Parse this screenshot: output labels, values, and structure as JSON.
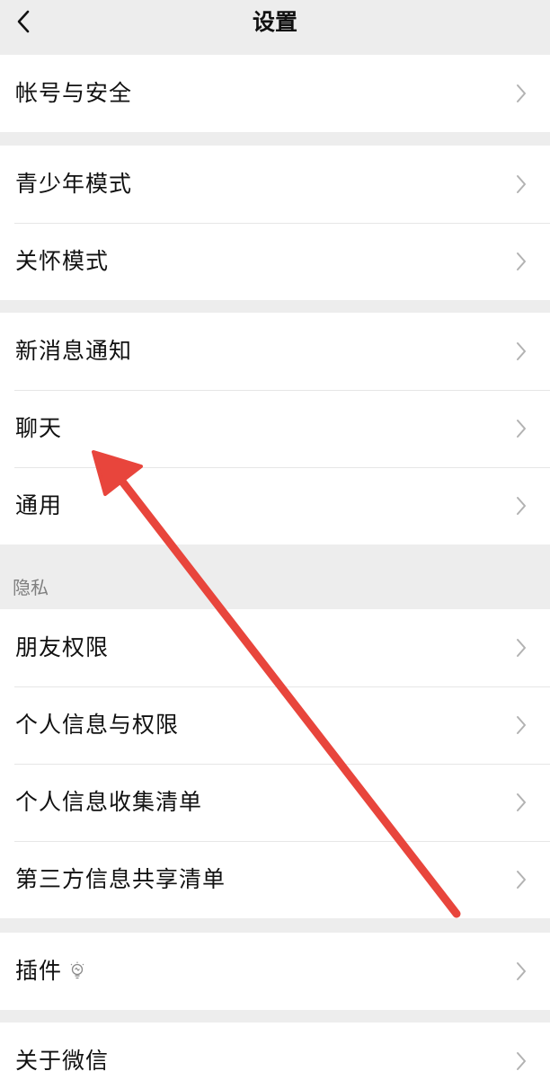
{
  "header": {
    "title": "设置",
    "back_icon": "chevron-left-icon"
  },
  "groups": [
    {
      "items": [
        {
          "label": "帐号与安全"
        }
      ]
    },
    {
      "items": [
        {
          "label": "青少年模式"
        },
        {
          "label": "关怀模式"
        }
      ]
    },
    {
      "items": [
        {
          "label": "新消息通知"
        },
        {
          "label": "聊天"
        },
        {
          "label": "通用"
        }
      ]
    },
    {
      "header": "隐私",
      "items": [
        {
          "label": "朋友权限"
        },
        {
          "label": "个人信息与权限"
        },
        {
          "label": "个人信息收集清单"
        },
        {
          "label": "第三方信息共享清单"
        }
      ]
    },
    {
      "items": [
        {
          "label": "插件",
          "icon": "lightbulb-icon"
        }
      ]
    },
    {
      "items": [
        {
          "label": "关于微信"
        }
      ]
    }
  ],
  "colors": {
    "background": "#ededed",
    "row_background": "#ffffff",
    "text": "#111111",
    "secondary_text": "#7f7f7f",
    "chevron": "#b2b2b2",
    "annotation_arrow": "#e8453c"
  }
}
